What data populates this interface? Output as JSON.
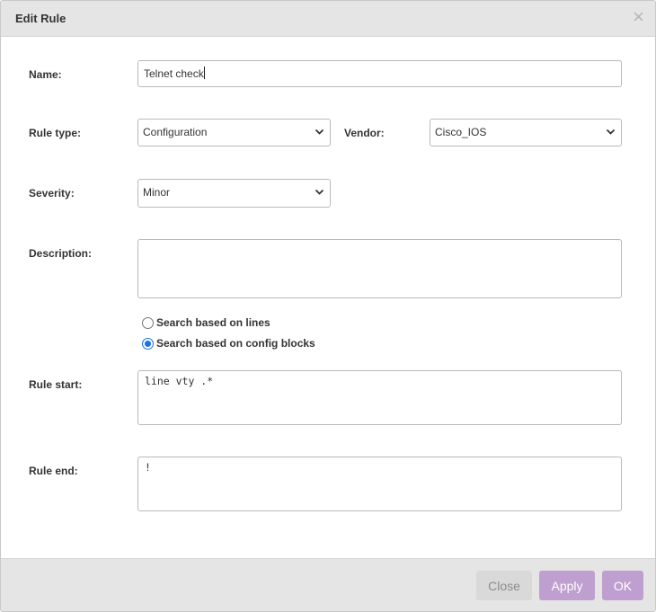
{
  "dialog": {
    "title": "Edit Rule",
    "close_glyph": "×"
  },
  "form": {
    "name": {
      "label": "Name:",
      "value": "Telnet check"
    },
    "rule_type": {
      "label": "Rule type:",
      "value": "Configuration"
    },
    "vendor": {
      "label": "Vendor:",
      "value": "Cisco_IOS"
    },
    "severity": {
      "label": "Severity:",
      "value": "Minor"
    },
    "description": {
      "label": "Description:",
      "value": ""
    },
    "search_mode": {
      "options": [
        {
          "label": "Search based on lines",
          "checked": false
        },
        {
          "label": "Search based on config blocks",
          "checked": true
        }
      ]
    },
    "rule_start": {
      "label": "Rule start:",
      "value": "line vty .*"
    },
    "rule_end": {
      "label": "Rule end:",
      "value": "!"
    }
  },
  "footer": {
    "close_label": "Close",
    "apply_label": "Apply",
    "ok_label": "OK"
  },
  "colors": {
    "header_bg": "#e5e5e5",
    "primary_button": "#bf9fcf",
    "disabled_button": "#d9d9d9",
    "radio_accent": "#1a73e8"
  },
  "icons": {
    "dialog_close": "close-icon",
    "select_arrow": "chevron-down-icon"
  }
}
